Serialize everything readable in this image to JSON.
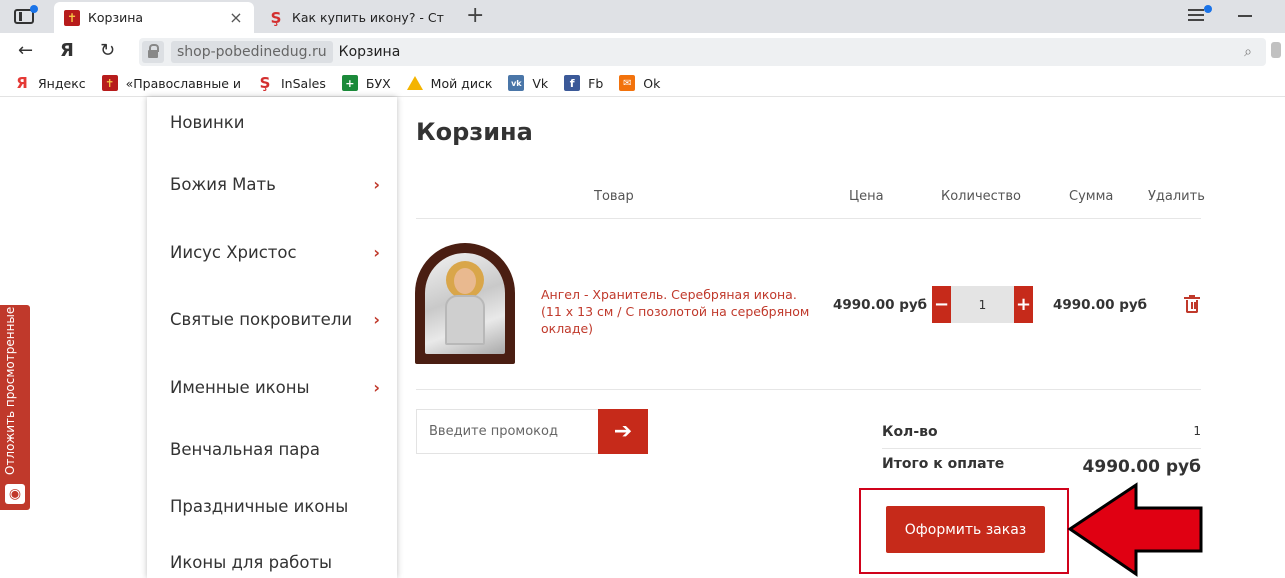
{
  "browser": {
    "tabs": [
      {
        "label": "Корзина",
        "active": true
      },
      {
        "label": "Как купить икону? - Стран",
        "active": false
      }
    ],
    "new_tab_symbol": "+",
    "address": {
      "domain": "shop-pobedinedug.ru",
      "title": "Корзина"
    },
    "nav": {
      "back": "←",
      "yandex": "Я",
      "reload": "↻"
    },
    "bookmarks": [
      {
        "label": "Яндекс",
        "icon": "yandex-icon"
      },
      {
        "label": "«Православные и",
        "icon": "orthodox-cross-icon"
      },
      {
        "label": "InSales",
        "icon": "insales-icon"
      },
      {
        "label": "БУХ",
        "icon": "buh-icon"
      },
      {
        "label": "Мой диск",
        "icon": "google-drive-icon"
      },
      {
        "label": "Vk",
        "icon": "vk-icon"
      },
      {
        "label": "Fb",
        "icon": "facebook-icon"
      },
      {
        "label": "Ok",
        "icon": "ok-icon"
      }
    ]
  },
  "sidebar": {
    "items": [
      {
        "label": "Новинки",
        "has_submenu": false
      },
      {
        "label": "Божия Мать",
        "has_submenu": true
      },
      {
        "label": "Иисус Христос",
        "has_submenu": true
      },
      {
        "label": "Святые покровители",
        "has_submenu": true
      },
      {
        "label": "Именные иконы",
        "has_submenu": true
      },
      {
        "label": "Венчальная пара",
        "has_submenu": false
      },
      {
        "label": "Праздничные иконы",
        "has_submenu": false
      },
      {
        "label": "Иконы для работы",
        "has_submenu": false
      }
    ],
    "chevron": "›"
  },
  "recently_viewed": {
    "label": "Отложить просмотренные"
  },
  "cart": {
    "title": "Корзина",
    "headers": {
      "product": "Товар",
      "price": "Цена",
      "quantity": "Количество",
      "sum": "Сумма",
      "delete": "Удалить"
    },
    "items": [
      {
        "name": "Ангел - Хранитель. Серебряная икона. (11 х 13 см / С позолотой на серебряном окладе)",
        "price": "4990.00 руб",
        "quantity": "1",
        "sum": "4990.00 руб"
      }
    ],
    "qty_minus": "−",
    "qty_plus": "+",
    "promo": {
      "placeholder": "Введите промокод",
      "button_symbol": "➔"
    },
    "summary": {
      "count_label": "Кол-во",
      "count_value": "1",
      "total_label": "Итого к оплате",
      "total_value": "4990.00 руб"
    },
    "checkout_label": "Оформить заказ"
  },
  "colors": {
    "accent": "#c62a1a",
    "annotation": "#d0021b",
    "link": "#c0392b"
  }
}
